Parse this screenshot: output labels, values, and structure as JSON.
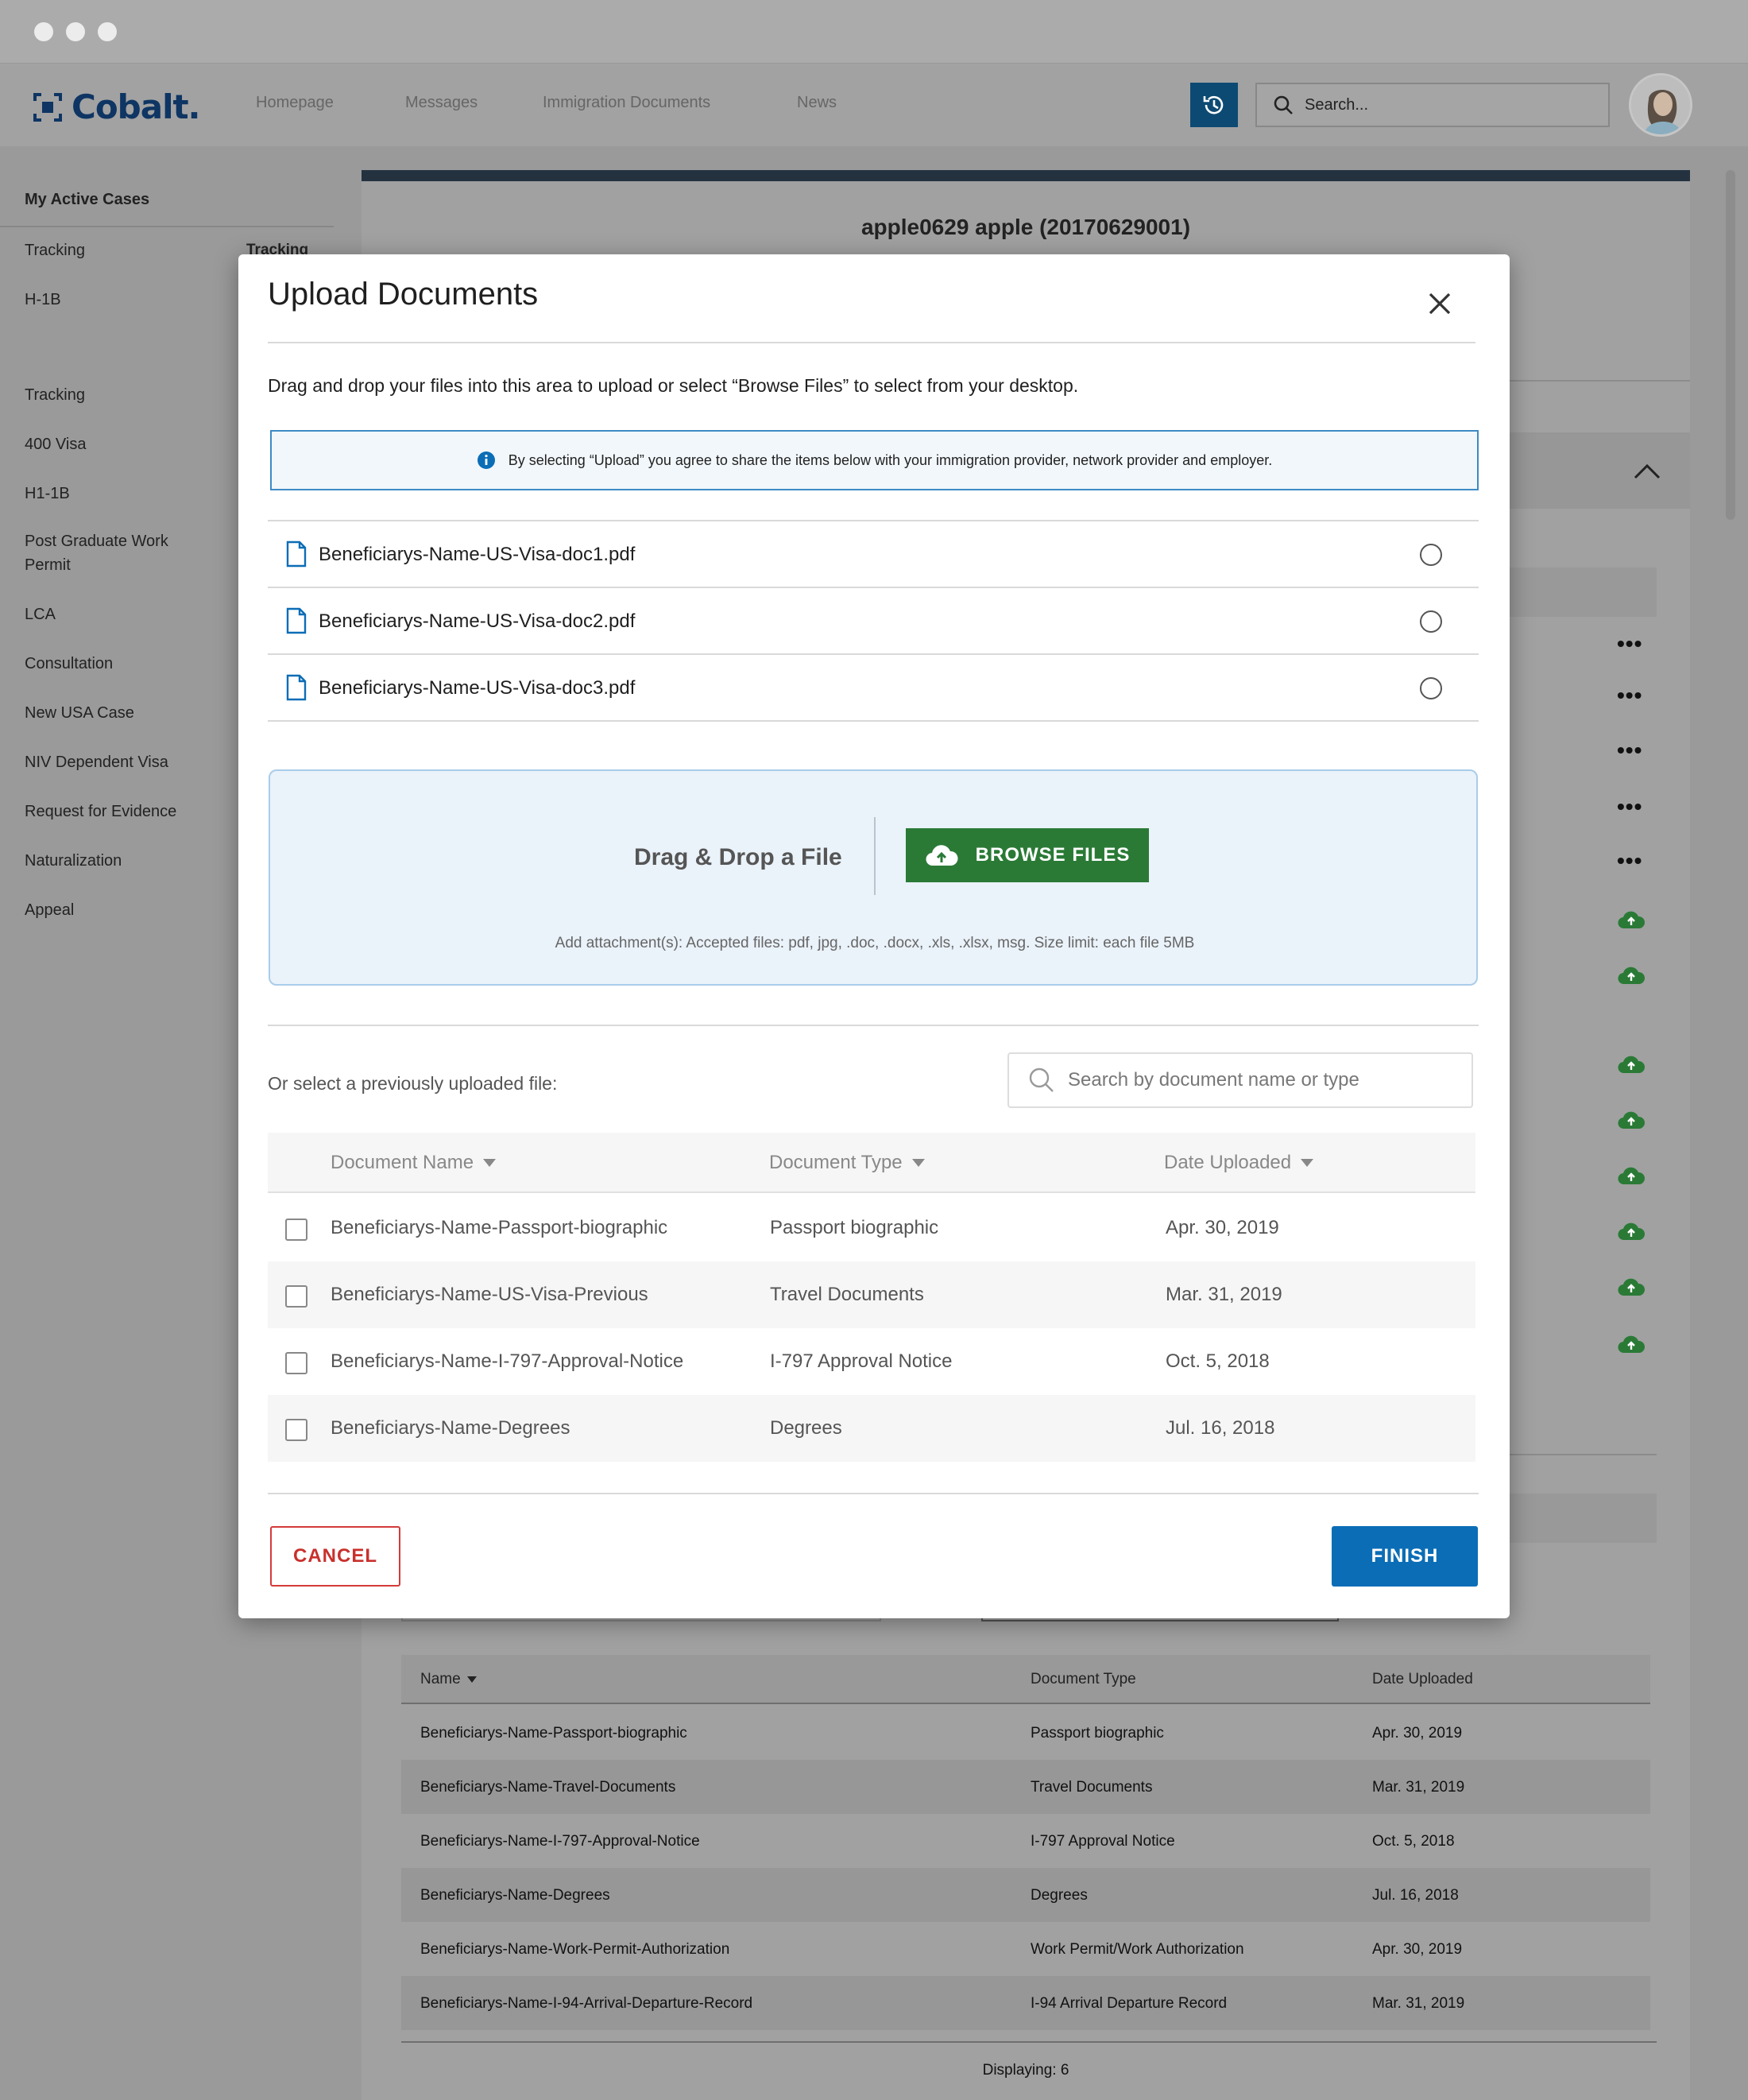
{
  "app": {
    "brand": "Cobalt.",
    "nav_links": [
      "Homepage",
      "Messages",
      "Immigration Documents",
      "News"
    ],
    "search_placeholder": "Search..."
  },
  "sidebar": {
    "heading": "My Active Cases",
    "items": [
      "Tracking",
      "H-1B",
      "Tracking",
      "400 Visa",
      "H1-1B",
      "Post Graduate Work Permit",
      "LCA",
      "Consultation",
      "New USA Case",
      "NIV Dependent Visa",
      "Request for Evidence",
      "Naturalization",
      "Appeal"
    ],
    "overlay_label": "Tracking"
  },
  "background": {
    "case_title": "apple0629 apple (20170629001)",
    "table": {
      "headers": [
        "Name",
        "Document Type",
        "Date Uploaded"
      ],
      "rows": [
        [
          "Beneficiarys-Name-Passport-biographic",
          "Passport biographic",
          "Apr. 30, 2019"
        ],
        [
          "Beneficiarys-Name-Travel-Documents",
          "Travel Documents",
          "Mar. 31, 2019"
        ],
        [
          "Beneficiarys-Name-I-797-Approval-Notice",
          "I-797 Approval Notice",
          "Oct. 5, 2018"
        ],
        [
          "Beneficiarys-Name-Degrees",
          "Degrees",
          "Jul. 16, 2018"
        ],
        [
          "Beneficiarys-Name-Work-Permit-Authorization",
          "Work Permit/Work Authorization",
          "Apr. 30, 2019"
        ],
        [
          "Beneficiarys-Name-I-94-Arrival-Departure-Record",
          "I-94 Arrival Departure Record",
          "Mar. 31, 2019"
        ]
      ],
      "displaying": "Displaying: 6"
    }
  },
  "modal": {
    "title": "Upload Documents",
    "intro": "Drag and drop your files into this area to upload or select “Browse Files” to select from your desktop.",
    "notice": "By selecting “Upload” you agree to share the items below with your immigration provider, network provider and employer.",
    "files": [
      "Beneficiarys-Name-US-Visa-doc1.pdf",
      "Beneficiarys-Name-US-Visa-doc2.pdf",
      "Beneficiarys-Name-US-Visa-doc3.pdf"
    ],
    "drop_label": "Drag & Drop a File",
    "browse_label": "BROWSE FILES",
    "drop_help": "Add attachment(s): Accepted files: pdf, jpg, .doc, .docx, .xls, .xlsx, msg. Size limit: each file 5MB",
    "prev_label": "Or select a previously uploaded file:",
    "search_placeholder": "Search by document name or type",
    "table": {
      "headers": [
        "Document Name",
        "Document Type",
        "Date Uploaded"
      ],
      "rows": [
        [
          "Beneficiarys-Name-Passport-biographic",
          "Passport biographic",
          "Apr. 30, 2019"
        ],
        [
          "Beneficiarys-Name-US-Visa-Previous",
          "Travel Documents",
          "Mar. 31, 2019"
        ],
        [
          "Beneficiarys-Name-I-797-Approval-Notice",
          "I-797 Approval Notice",
          "Oct. 5, 2018"
        ],
        [
          "Beneficiarys-Name-Degrees",
          "Degrees",
          "Jul. 16, 2018"
        ]
      ]
    },
    "cancel_label": "CANCEL",
    "finish_label": "FINISH"
  },
  "colors": {
    "brand": "#0e3563",
    "primary": "#0b6db6",
    "success": "#2a7a36",
    "danger": "#c9302c"
  }
}
